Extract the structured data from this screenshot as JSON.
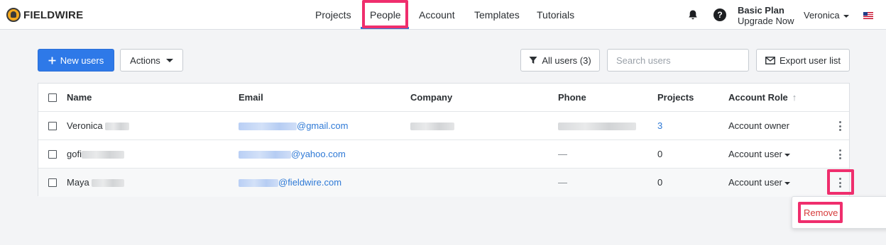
{
  "app": {
    "brand": "FIELDWIRE"
  },
  "nav": {
    "items": [
      {
        "label": "Projects"
      },
      {
        "label": "People"
      },
      {
        "label": "Account"
      },
      {
        "label": "Templates"
      },
      {
        "label": "Tutorials"
      }
    ],
    "active": "People"
  },
  "header": {
    "help_label": "?",
    "plan_title": "Basic Plan",
    "plan_upgrade": "Upgrade Now",
    "user_name": "Veronica"
  },
  "toolbar": {
    "new_users_label": "New users",
    "actions_label": "Actions",
    "filter_label": "All users (3)",
    "search_placeholder": "Search users",
    "export_label": "Export user list"
  },
  "table": {
    "columns": [
      "Name",
      "Email",
      "Company",
      "Phone",
      "Projects",
      "Account Role"
    ],
    "sort_indicator": "↑",
    "rows": [
      {
        "name": "Veronica",
        "email": "@gmail.com",
        "phone": "",
        "projects": "3",
        "role": "Account owner",
        "role_has_dropdown": false
      },
      {
        "name": "gofi",
        "email": "@yahoo.com",
        "phone": "—",
        "projects": "0",
        "role": "Account user",
        "role_has_dropdown": true
      },
      {
        "name": "Maya",
        "email": "@fieldwire.com",
        "phone": "—",
        "projects": "0",
        "role": "Account user",
        "role_has_dropdown": true
      }
    ]
  },
  "row_menu": {
    "remove_label": "Remove"
  },
  "colors": {
    "accent": "#2e79e8",
    "highlight": "#ef2e6d",
    "link": "#2e79d6",
    "danger": "#d63b3b"
  }
}
